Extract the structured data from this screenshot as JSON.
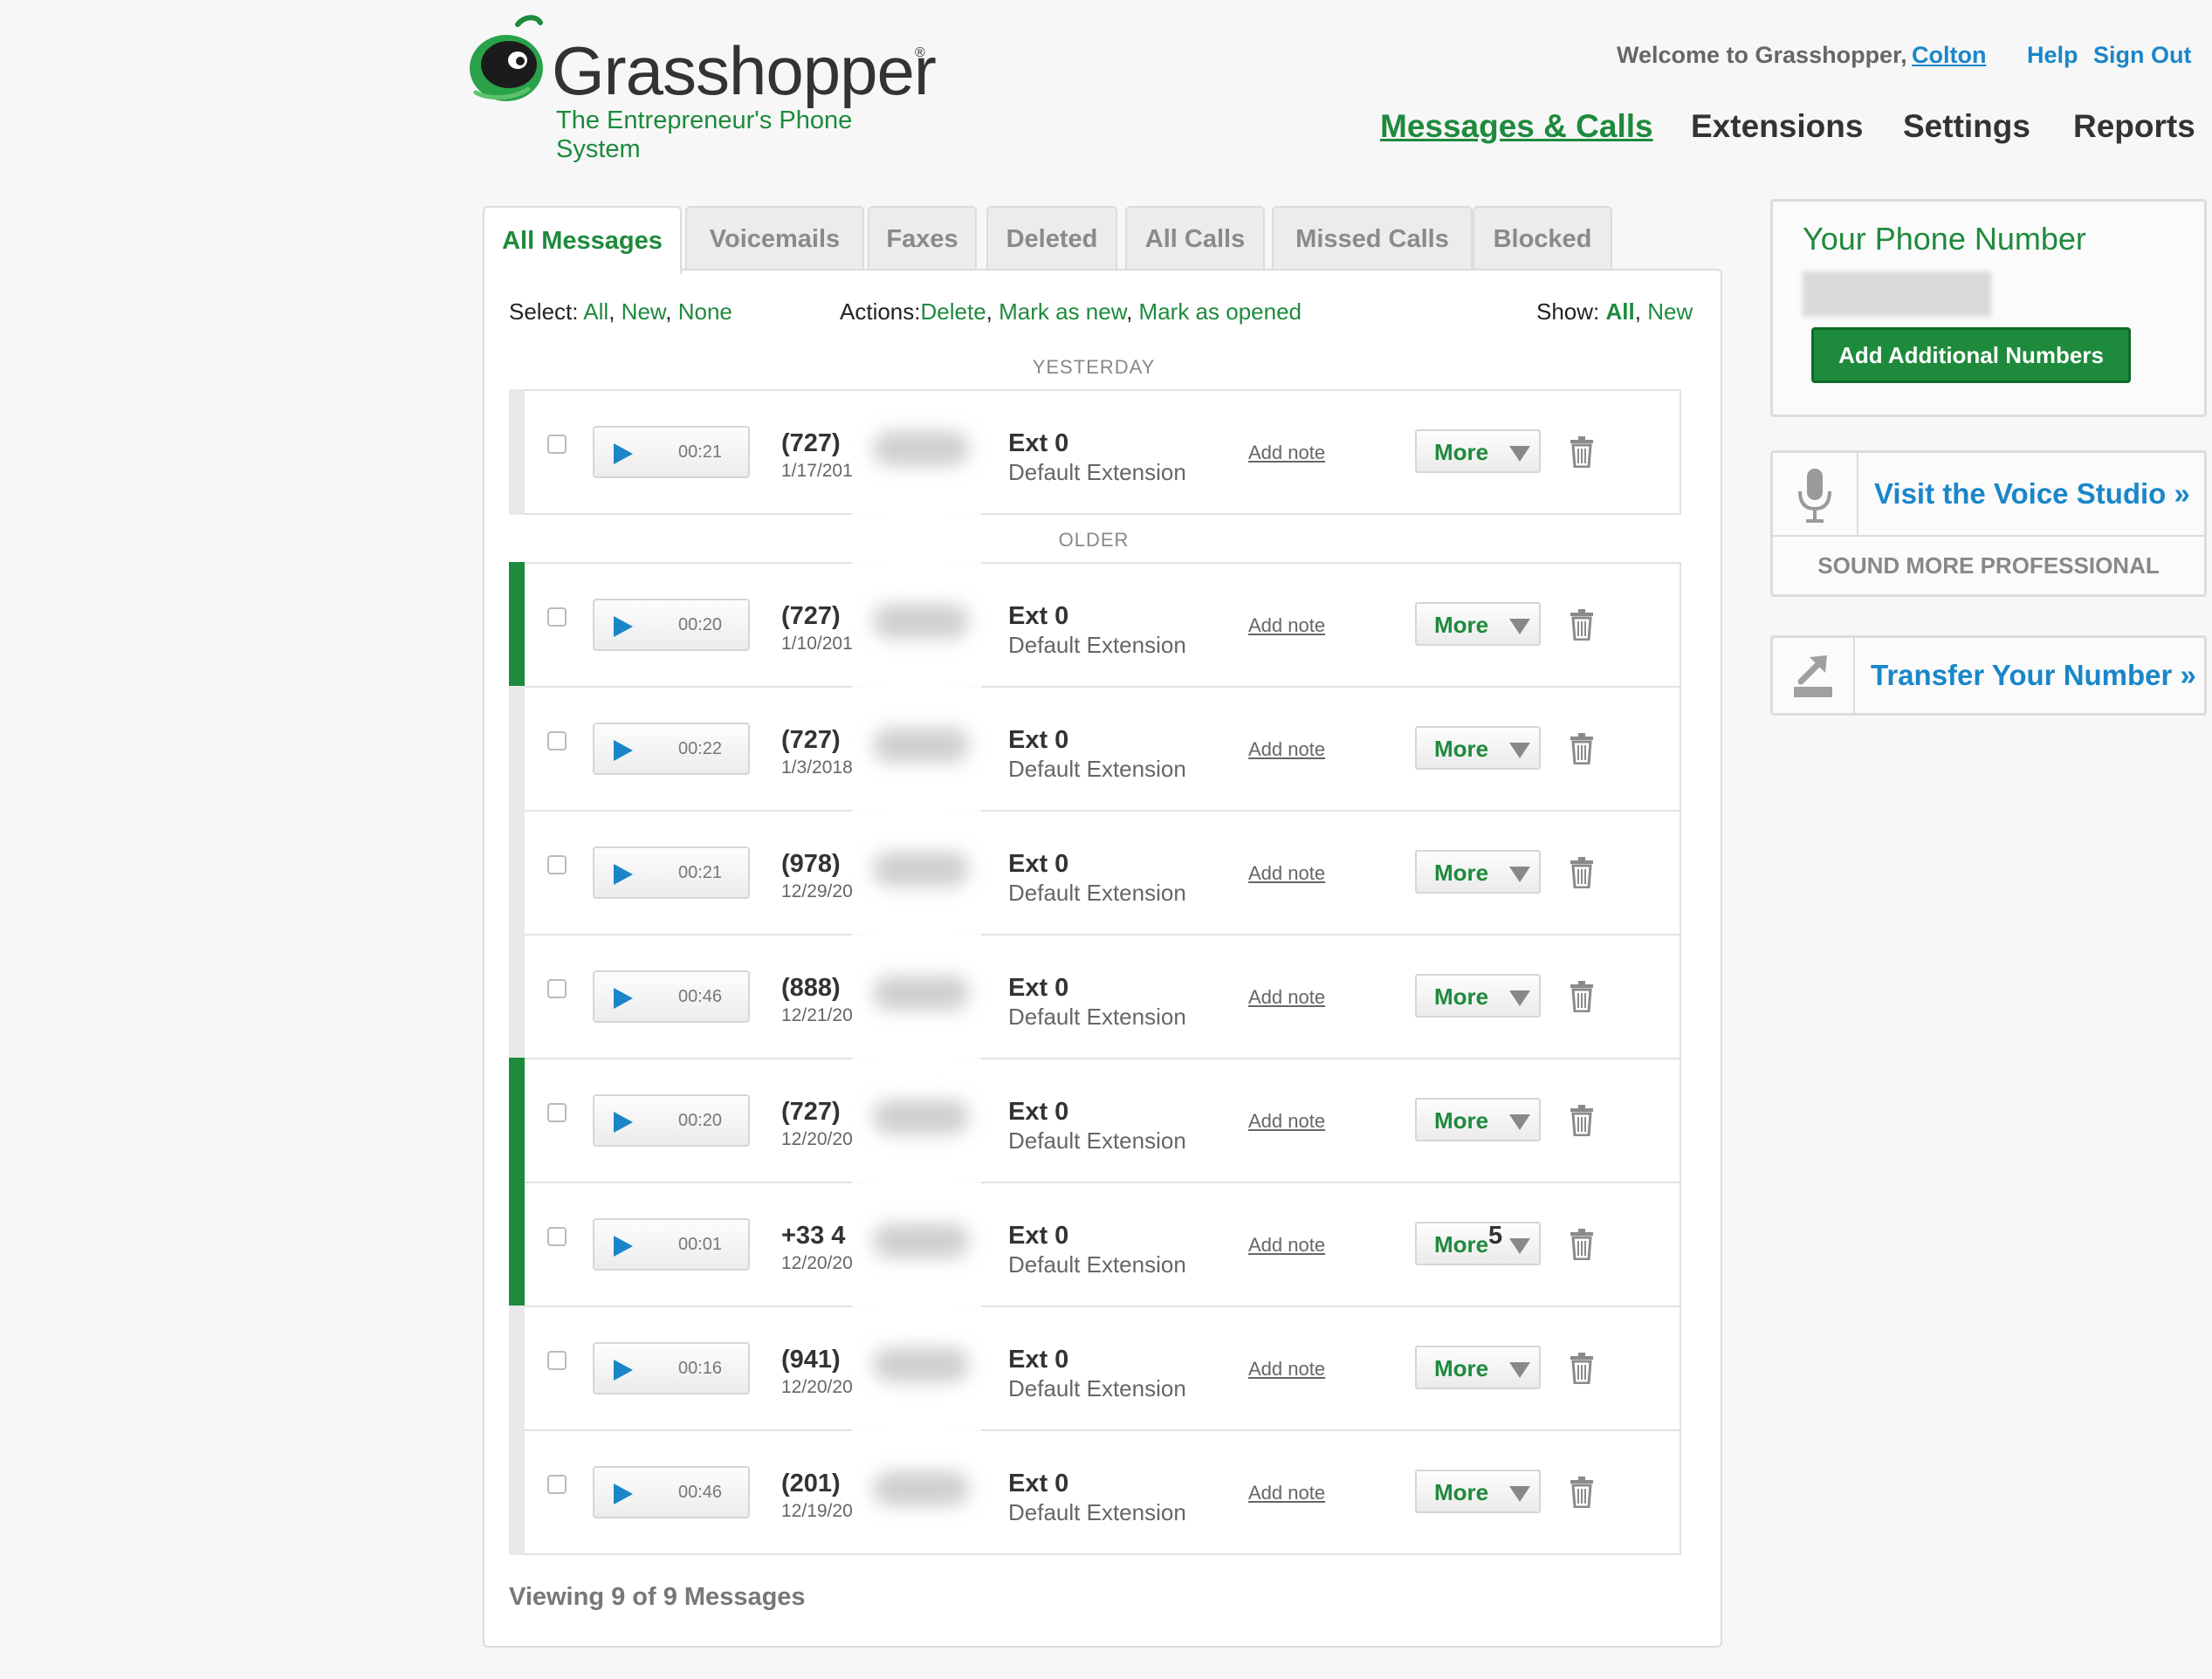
{
  "brand": {
    "name": "Grasshopper",
    "registered": "®",
    "tagline": "The Entrepreneur's Phone System",
    "color": "#1e8a3c"
  },
  "header": {
    "welcome": "Welcome to Grasshopper,",
    "user": "Colton",
    "help": "Help",
    "sign_out": "Sign Out"
  },
  "nav": [
    "Messages & Calls",
    "Extensions",
    "Settings",
    "Reports"
  ],
  "tabs": [
    "All Messages",
    "Voicemails",
    "Faxes",
    "Deleted",
    "All Calls",
    "Missed Calls",
    "Blocked"
  ],
  "controls": {
    "select_label": "Select:",
    "select_all": "All",
    "select_new": "New",
    "select_none": "None",
    "actions_label": "Actions:",
    "action_delete": "Delete",
    "action_mark_new": "Mark as new",
    "action_mark_opened": "Mark as opened",
    "show_label": "Show:",
    "show_all": "All",
    "show_new": "New",
    "comma": ","
  },
  "sections": {
    "yesterday": "YESTERDAY",
    "older": "OLDER"
  },
  "row_labels": {
    "ext": "Ext 0",
    "ext_desc": "Default Extension",
    "note": "Add note",
    "more": "More"
  },
  "messages": [
    {
      "duration": "00:21",
      "phone": "(727)",
      "date": "1/17/201",
      "unread": false
    },
    {
      "duration": "00:20",
      "phone": "(727)",
      "date": "1/10/201",
      "unread": true
    },
    {
      "duration": "00:22",
      "phone": "(727)",
      "date": "1/3/2018",
      "unread": false
    },
    {
      "duration": "00:21",
      "phone": "(978)",
      "date": "12/29/20",
      "unread": false
    },
    {
      "duration": "00:46",
      "phone": "(888)",
      "date": "12/21/20",
      "unread": false
    },
    {
      "duration": "00:20",
      "phone": "(727)",
      "date": "12/20/20",
      "unread": true
    },
    {
      "duration": "00:01",
      "phone": "+33 4",
      "phone_suffix": "5",
      "date": "12/20/20",
      "unread": true
    },
    {
      "duration": "00:16",
      "phone": "(941)",
      "date": "12/20/20",
      "unread": false
    },
    {
      "duration": "00:46",
      "phone": "(201)",
      "date": "12/19/20",
      "unread": false
    }
  ],
  "footer": {
    "viewing": "Viewing 9 of 9 Messages"
  },
  "sidebar": {
    "phone_title": "Your Phone Number",
    "add_button": "Add Additional Numbers",
    "studio_link": "Visit the Voice Studio »",
    "studio_sub": "SOUND MORE PROFESSIONAL",
    "transfer_link": "Transfer Your Number »",
    "icons": [
      "microphone-icon",
      "transfer-arrow-icon"
    ]
  },
  "colors": {
    "green": "#1e8a3c",
    "link_blue": "#1a86c8",
    "play_blue": "#1a86c8"
  }
}
